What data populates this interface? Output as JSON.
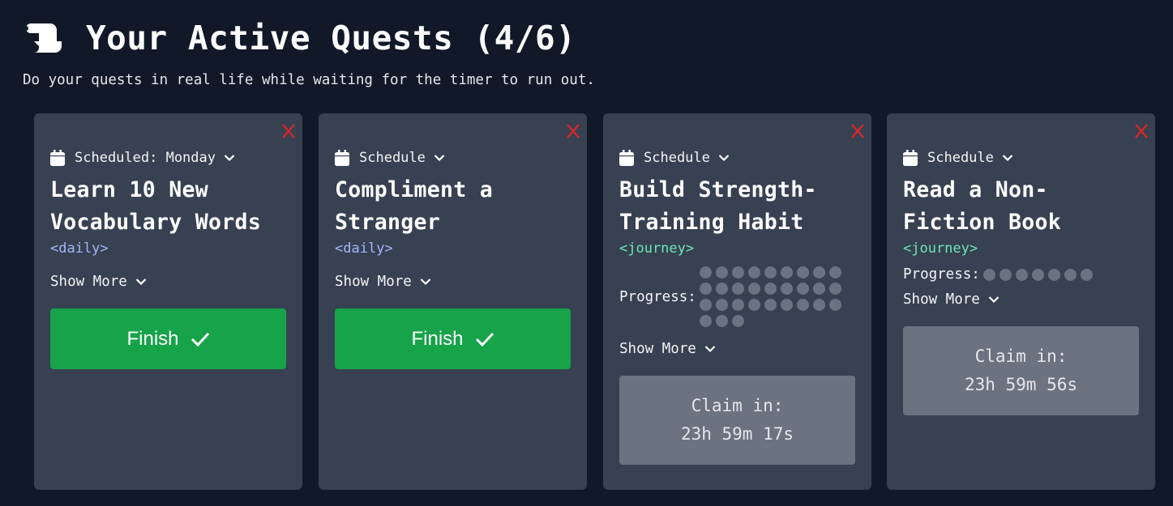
{
  "header": {
    "icon": "scroll-icon",
    "title": "Your Active Quests (4/6)",
    "subtitle": "Do your quests in real life while waiting for the timer to run out."
  },
  "quests": [
    {
      "schedule_label": "Scheduled: Monday",
      "title": "Learn 10 New Vocabulary Words",
      "tag": "<daily>",
      "show_more": "Show More",
      "action": "finish",
      "finish_label": "Finish"
    },
    {
      "schedule_label": "Schedule",
      "title": "Compliment a Stranger",
      "tag": "<daily>",
      "show_more": "Show More",
      "action": "finish",
      "finish_label": "Finish"
    },
    {
      "schedule_label": "Schedule",
      "title": "Build Strength-Training Habit",
      "tag": "<journey>",
      "progress_label": "Progress:",
      "progress_total": 30,
      "progress_done": 0,
      "show_more": "Show More",
      "action": "claim",
      "claim_label": "Claim in:",
      "claim_time": "23h 59m 17s"
    },
    {
      "schedule_label": "Schedule",
      "title": "Read a Non-Fiction Book",
      "tag": "<journey>",
      "progress_label": "Progress:",
      "progress_total": 7,
      "progress_done": 0,
      "show_more": "Show More",
      "action": "claim",
      "claim_label": "Claim in:",
      "claim_time": "23h 59m 56s"
    }
  ],
  "colors": {
    "background": "#111827",
    "card": "#374151",
    "finish": "#16a34a",
    "claim": "#6b7280",
    "close": "#dc2626",
    "daily_tag": "#a5b4fc",
    "journey_tag": "#6ee7b7",
    "progress_dot": "#6b7280"
  }
}
